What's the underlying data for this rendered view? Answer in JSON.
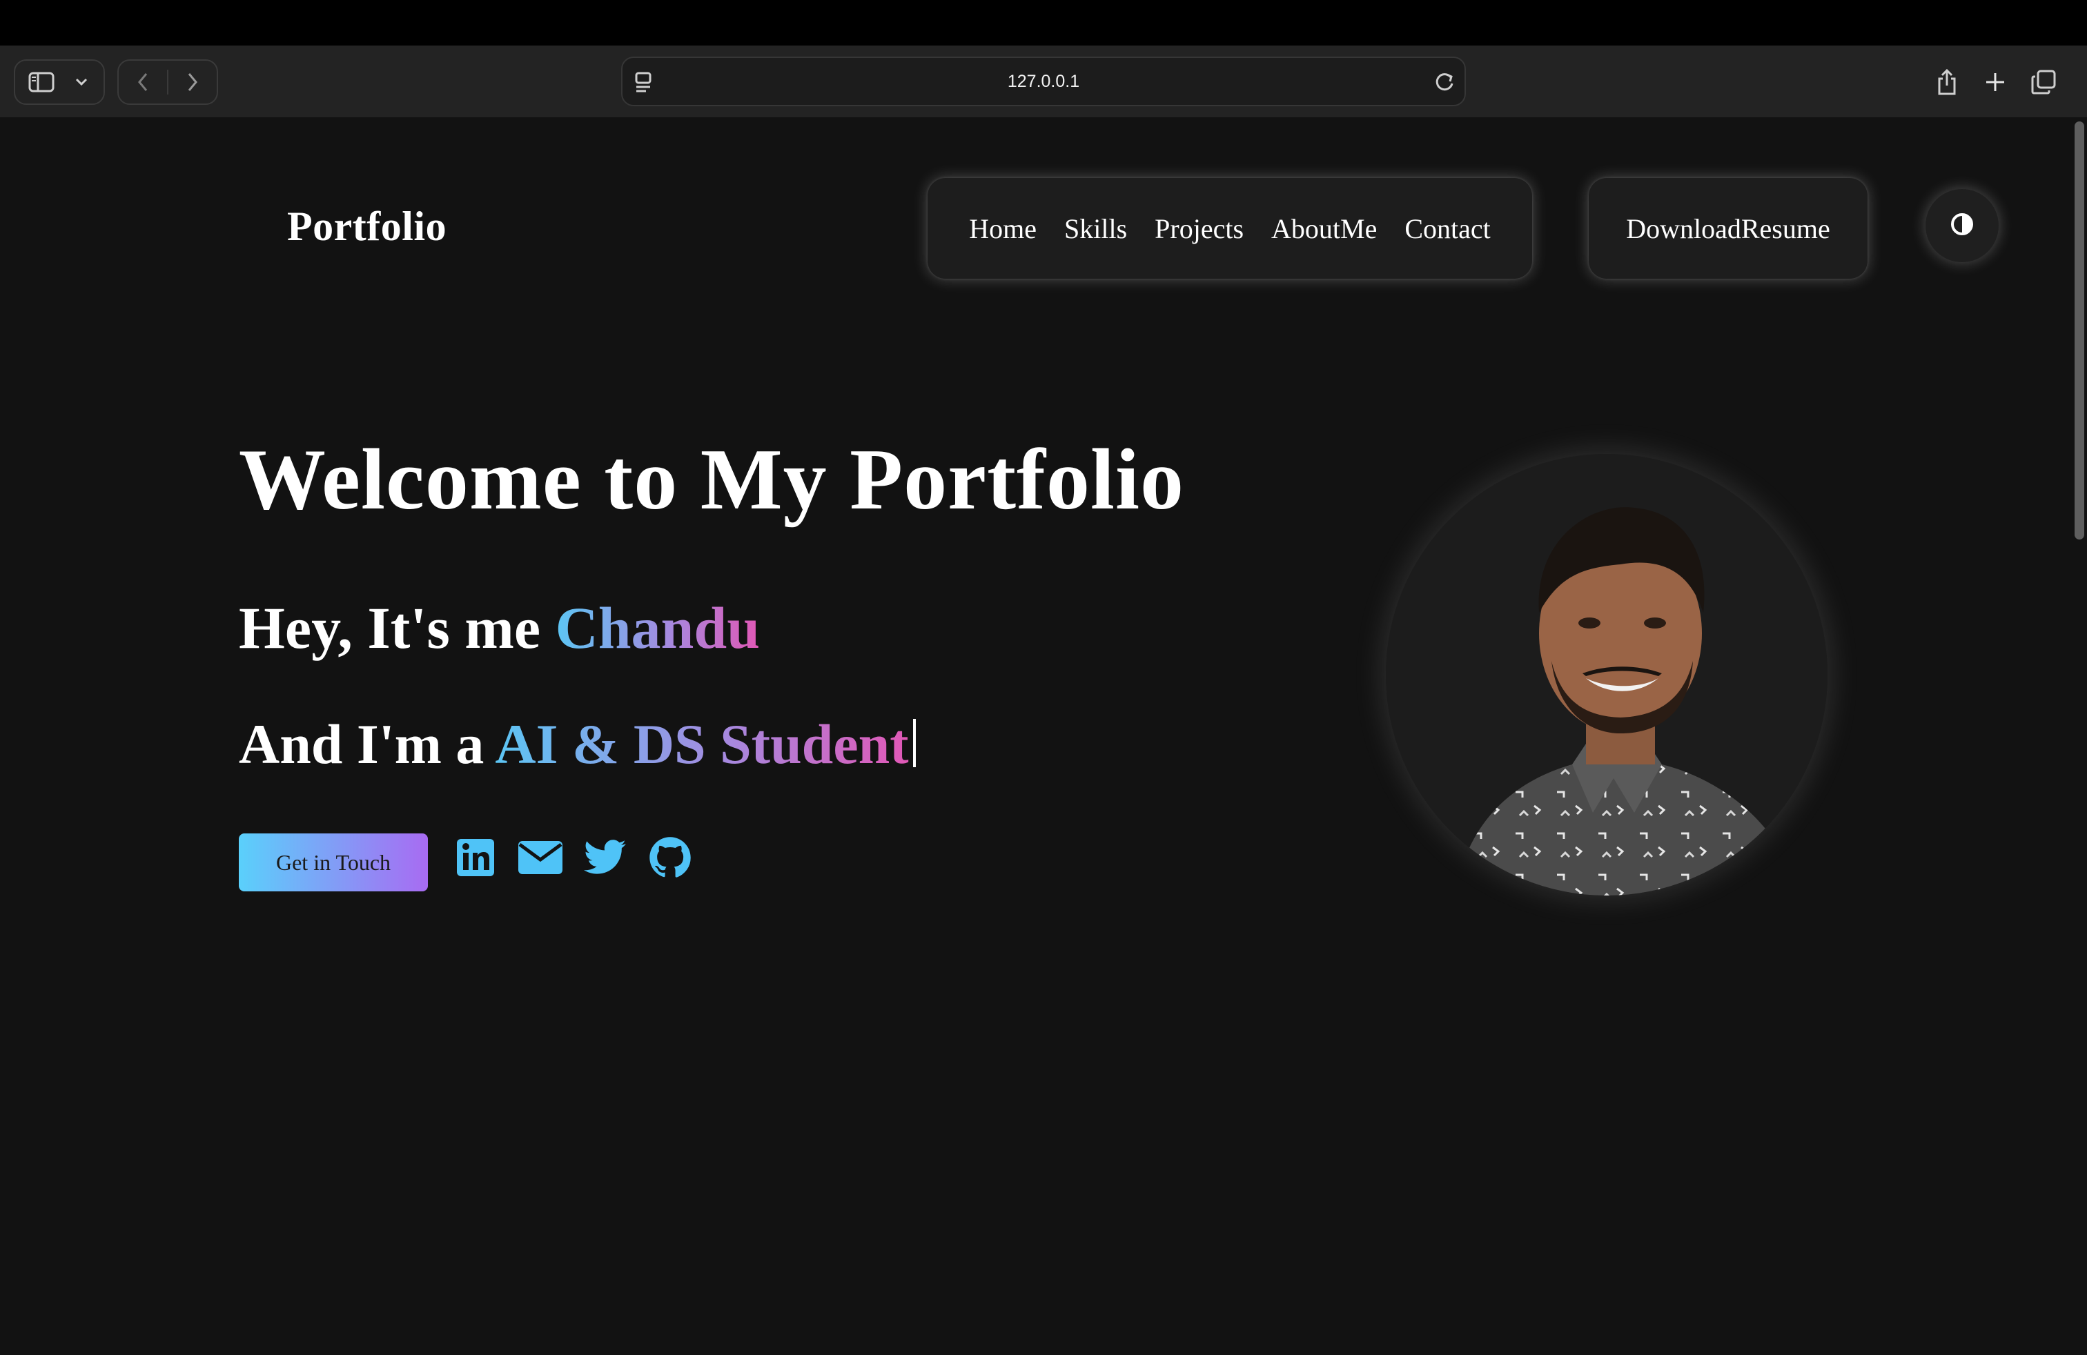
{
  "browser": {
    "url": "127.0.0.1"
  },
  "header": {
    "logo": "Portfolio",
    "nav": [
      "Home",
      "Skills",
      "Projects",
      "AboutMe",
      "Contact"
    ],
    "resume_label": "DownloadResume"
  },
  "hero": {
    "title": "Welcome to My Portfolio",
    "greeting_prefix": "Hey, It's me ",
    "name": "Chandu",
    "role_prefix": "And I'm a ",
    "role": "AI & DS Student",
    "cta_label": "Get in Touch",
    "socials": [
      "linkedin-icon",
      "email-icon",
      "twitter-icon",
      "github-icon"
    ]
  },
  "colors": {
    "page_bg": "#121212",
    "accent_blue": "#5cc6f4",
    "accent_pink": "#e158b6",
    "icon_blue": "#4fc3f7"
  }
}
